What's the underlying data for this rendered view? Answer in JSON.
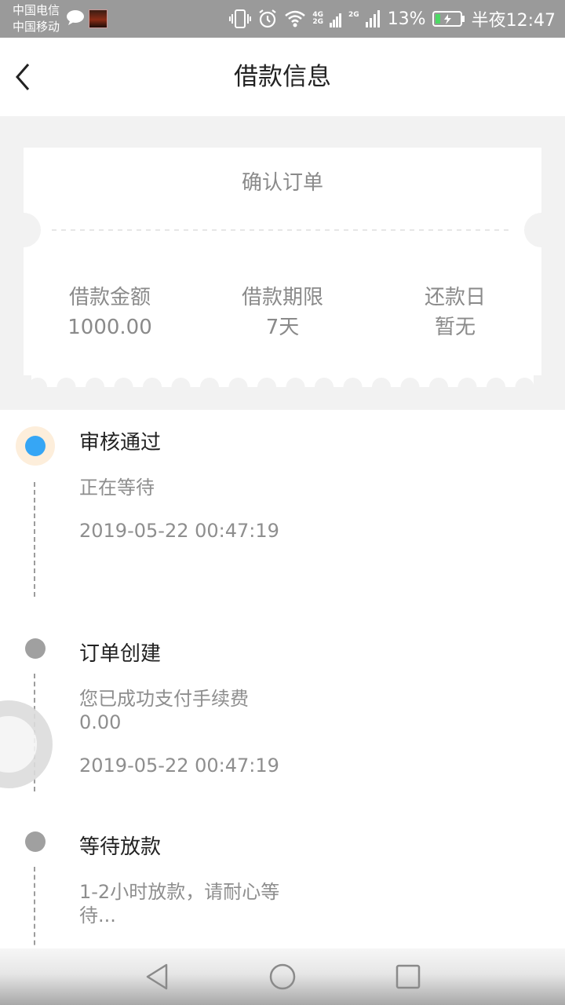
{
  "status_bar": {
    "carrier_1": "中国电信",
    "carrier_2": "中国移动",
    "net_top": "4G",
    "net_bottom": "2G",
    "net_2": "2G",
    "battery_percent": "13%",
    "time": "半夜12:47"
  },
  "header": {
    "title": "借款信息"
  },
  "ticket": {
    "title": "确认订单",
    "stats": [
      {
        "label": "借款金额",
        "value": "1000.00"
      },
      {
        "label": "借款期限",
        "value": "7天"
      },
      {
        "label": "还款日",
        "value": "暂无"
      }
    ]
  },
  "timeline": {
    "steps": [
      {
        "title": "审核通过",
        "desc": "正在等待",
        "time": "2019-05-22 00:47:19",
        "state": "active"
      },
      {
        "title": "订单创建",
        "desc": "您已成功支付手续费0.00",
        "time": "2019-05-22 00:47:19",
        "state": "done"
      },
      {
        "title": "等待放款",
        "desc": "1-2小时放款，请耐心等待...",
        "time": "",
        "state": "pending"
      }
    ]
  },
  "colors": {
    "active_dot": "#36a6f5",
    "active_halo": "#fdeedb",
    "inactive_dot": "#a0a0a0",
    "page_bg": "#f2f2f2"
  }
}
